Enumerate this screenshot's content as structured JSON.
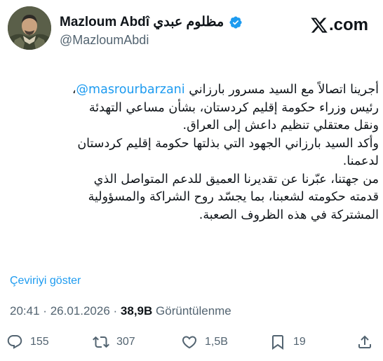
{
  "author": {
    "display_name": "Mazloum Abdî مظلوم عبدي",
    "handle": "@MazloumAbdi",
    "verified": true
  },
  "brand": {
    "icon": "x-logo-icon",
    "suffix": ".com"
  },
  "tweet": {
    "mention": "@masrourbarzani",
    "line1_rest": "أجرينا اتصالاً مع السيد مسرور بارزاني",
    "line1_end": "،",
    "line2": "رئيس وزراء حكومة إقليم كردستان، بشأن مساعي التهدئة",
    "line3": "ونقل معتقلي تنظيم داعش إلى العراق.",
    "line4": "وأكد السيد بارزاني الجهود التي بذلتها حكومة إقليم كردستان",
    "line5": "لدعمنا.",
    "line6": "من جهتنا، عبّرنا عن تقديرنا العميق للدعم المتواصل الذي",
    "line7": "قدمته حكومته لشعبنا، بما يجسّد روح الشراكة والمسؤولية",
    "line8": "المشتركة في هذه الظروف الصعبة."
  },
  "translate_label": "Çeviriyi göster",
  "meta": {
    "time": "20:41",
    "date": "26.01.2026",
    "separator": "·",
    "views_count": "38,9B",
    "views_label": "Görüntülenme"
  },
  "actions": {
    "replies": "155",
    "reposts": "307",
    "likes": "1,5B",
    "bookmarks": "19"
  },
  "colors": {
    "accent": "#1d9bf0",
    "text": "#0f1419",
    "muted": "#536471"
  }
}
